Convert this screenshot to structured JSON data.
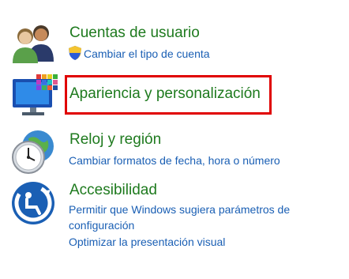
{
  "categories": [
    {
      "title": "Cuentas de usuario",
      "icon": "users-icon",
      "links": [
        "Cambiar el tipo de cuenta"
      ],
      "link_icon": "uac-shield-icon"
    },
    {
      "title": "Apariencia y personalización",
      "icon": "monitor-palette-icon",
      "links": [],
      "highlighted": true,
      "highlight_color": "#e00000"
    },
    {
      "title": "Reloj y región",
      "icon": "clock-globe-icon",
      "links": [
        "Cambiar formatos de fecha, hora o número"
      ]
    },
    {
      "title": "Accesibilidad",
      "icon": "accessibility-icon",
      "links": [
        "Permitir que Windows sugiera parámetros de configuración",
        "Optimizar la presentación visual"
      ]
    }
  ],
  "colors": {
    "title": "#1e7a1e",
    "link": "#1a5fb4"
  }
}
